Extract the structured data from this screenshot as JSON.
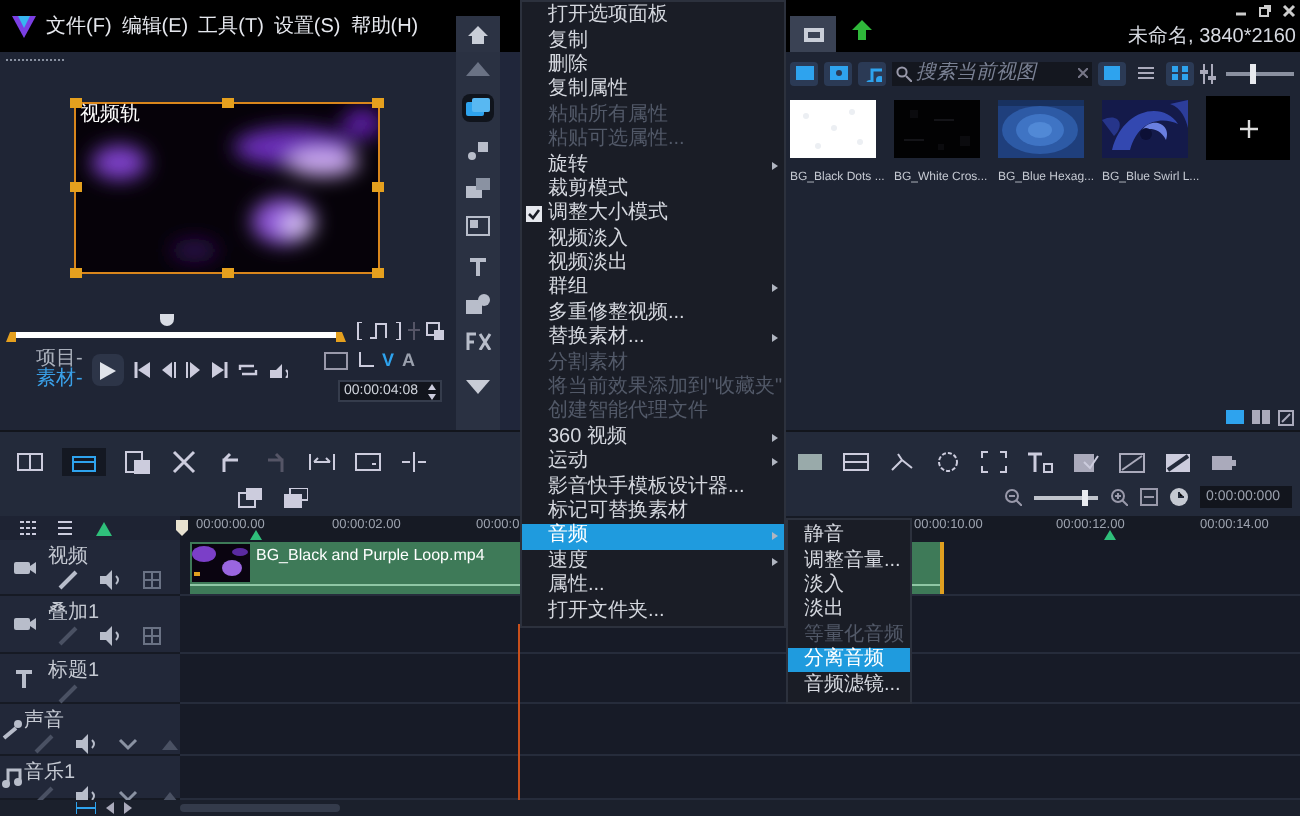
{
  "menu_bar": [
    "文件(F)",
    "编辑(E)",
    "工具(T)",
    "设置(S)",
    "帮助(H)"
  ],
  "title_bar": {
    "project_info": "未命名, 3840*2160"
  },
  "preview": {
    "label": "视频轨"
  },
  "player": {
    "scrubber": {
      "level": 0.47
    },
    "modes": [
      {
        "label": "项目-",
        "selected": false
      },
      {
        "label": "素材-",
        "selected": true
      }
    ],
    "track_toggles": [
      {
        "label": "V",
        "selected": true
      },
      {
        "label": "A",
        "selected": false
      }
    ],
    "timecode": "00:00:04:08"
  },
  "library": {
    "search": {
      "placeholder": "搜索当前视图"
    },
    "thumbnail_size": {
      "level": 0.4
    },
    "items": [
      {
        "label": "BG_Black Dots ..."
      },
      {
        "label": "BG_White Cros..."
      },
      {
        "label": "BG_Blue Hexag..."
      },
      {
        "label": "BG_Blue Swirl L..."
      }
    ]
  },
  "timeline": {
    "zoom": {
      "level": 0.8
    },
    "timecode": "0:00:00:000",
    "ruler": [
      "00:00:00.00",
      "00:00:02.00",
      "00:00:0",
      "00:00:10.00",
      "00:00:12.00",
      "00:00:14.00"
    ],
    "tracks": [
      {
        "name": "视频",
        "kind": "video"
      },
      {
        "name": "叠加1",
        "kind": "overlay"
      },
      {
        "name": "标题1",
        "kind": "title"
      },
      {
        "name": "声音",
        "kind": "voice"
      },
      {
        "name": "音乐1",
        "kind": "music"
      }
    ],
    "clip": {
      "label": "BG_Black and Purple Loop.mp4"
    }
  },
  "context_menu": [
    {
      "label": "打开选项面板",
      "disabled": false,
      "checked": false,
      "submenu": false,
      "selected": false
    },
    {
      "label": "复制",
      "disabled": false,
      "checked": false,
      "submenu": false,
      "selected": false
    },
    {
      "label": "删除",
      "disabled": false,
      "checked": false,
      "submenu": false,
      "selected": false
    },
    {
      "label": "复制属性",
      "disabled": false,
      "checked": false,
      "submenu": false,
      "selected": false
    },
    {
      "label": "粘贴所有属性",
      "disabled": true,
      "checked": false,
      "submenu": false,
      "selected": false
    },
    {
      "label": "粘贴可选属性...",
      "disabled": true,
      "checked": false,
      "submenu": false,
      "selected": false
    },
    {
      "label": "旋转",
      "disabled": false,
      "checked": false,
      "submenu": true,
      "selected": false
    },
    {
      "label": "裁剪模式",
      "disabled": false,
      "checked": false,
      "submenu": false,
      "selected": false
    },
    {
      "label": "调整大小模式",
      "disabled": false,
      "checked": true,
      "submenu": false,
      "selected": false
    },
    {
      "label": "视频淡入",
      "disabled": false,
      "checked": false,
      "submenu": false,
      "selected": false
    },
    {
      "label": "视频淡出",
      "disabled": false,
      "checked": false,
      "submenu": false,
      "selected": false
    },
    {
      "label": "群组",
      "disabled": false,
      "checked": false,
      "submenu": true,
      "selected": false
    },
    {
      "label": "多重修整视频...",
      "disabled": false,
      "checked": false,
      "submenu": false,
      "selected": false
    },
    {
      "label": "替换素材...",
      "disabled": false,
      "checked": false,
      "submenu": true,
      "selected": false
    },
    {
      "label": "分割素材",
      "disabled": true,
      "checked": false,
      "submenu": false,
      "selected": false
    },
    {
      "label": "将当前效果添加到\"收藏夹\"",
      "disabled": true,
      "checked": false,
      "submenu": false,
      "selected": false
    },
    {
      "label": "创建智能代理文件",
      "disabled": true,
      "checked": false,
      "submenu": false,
      "selected": false
    },
    {
      "label": "360 视频",
      "disabled": false,
      "checked": false,
      "submenu": true,
      "selected": false
    },
    {
      "label": "运动",
      "disabled": false,
      "checked": false,
      "submenu": true,
      "selected": false
    },
    {
      "label": "影音快手模板设计器...",
      "disabled": false,
      "checked": false,
      "submenu": false,
      "selected": false
    },
    {
      "label": "标记可替换素材",
      "disabled": false,
      "checked": false,
      "submenu": false,
      "selected": false
    },
    {
      "label": "音频",
      "disabled": false,
      "checked": false,
      "submenu": true,
      "selected": true
    },
    {
      "label": "速度",
      "disabled": false,
      "checked": false,
      "submenu": true,
      "selected": false
    },
    {
      "label": "属性...",
      "disabled": false,
      "checked": false,
      "submenu": false,
      "selected": false
    },
    {
      "label": "打开文件夹...",
      "disabled": false,
      "checked": false,
      "submenu": false,
      "selected": false
    }
  ],
  "audio_submenu": [
    {
      "label": "静音",
      "disabled": false,
      "selected": false
    },
    {
      "label": "调整音量...",
      "disabled": false,
      "selected": false
    },
    {
      "label": "淡入",
      "disabled": false,
      "selected": false
    },
    {
      "label": "淡出",
      "disabled": false,
      "selected": false
    },
    {
      "label": "等量化音频",
      "disabled": true,
      "selected": false
    },
    {
      "label": "分离音频",
      "disabled": false,
      "selected": true
    },
    {
      "label": "音频滤镜...",
      "disabled": false,
      "selected": false
    }
  ]
}
